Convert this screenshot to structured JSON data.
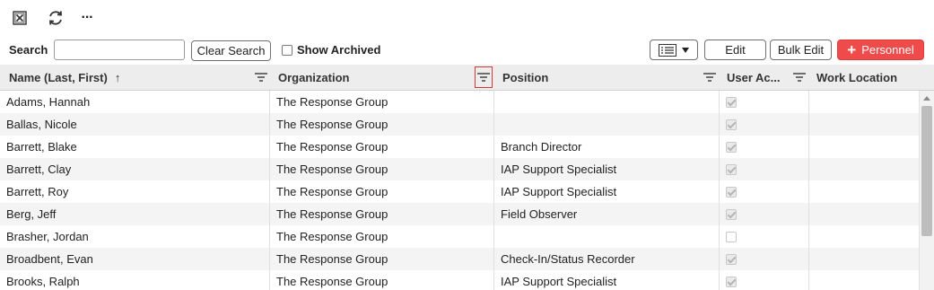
{
  "toolbar": {
    "search_label": "Search",
    "search_value": "",
    "clear_search_label": "Clear Search",
    "show_archived_label": "Show Archived",
    "edit_label": "Edit",
    "bulk_edit_label": "Bulk Edit",
    "personnel_label": "Personnel",
    "personnel_plus": "+"
  },
  "topbar": {
    "more_label": "···",
    "icons": [
      "excel-export-icon",
      "refresh-icon",
      "more-icon"
    ]
  },
  "columns": {
    "name": "Name (Last, First)",
    "sort_arrow": "↑",
    "organization": "Organization",
    "position": "Position",
    "user_account": "User Ac...",
    "work_location": "Work Location"
  },
  "rows": [
    {
      "name": "Adams, Hannah",
      "organization": "The Response Group",
      "position": "",
      "user": true
    },
    {
      "name": "Ballas, Nicole",
      "organization": "The Response Group",
      "position": "",
      "user": true
    },
    {
      "name": "Barrett, Blake",
      "organization": "The Response Group",
      "position": "Branch Director",
      "user": true
    },
    {
      "name": "Barrett, Clay",
      "organization": "The Response Group",
      "position": "IAP Support Specialist",
      "user": true
    },
    {
      "name": "Barrett, Roy",
      "organization": "The Response Group",
      "position": "IAP Support Specialist",
      "user": true
    },
    {
      "name": "Berg, Jeff",
      "organization": "The Response Group",
      "position": "Field Observer",
      "user": true
    },
    {
      "name": "Brasher, Jordan",
      "organization": "The Response Group",
      "position": "",
      "user": false
    },
    {
      "name": "Broadbent, Evan",
      "organization": "The Response Group",
      "position": "Check-In/Status Recorder",
      "user": true
    },
    {
      "name": "Brooks, Ralph",
      "organization": "The Response Group",
      "position": "IAP Support Specialist",
      "user": true
    }
  ],
  "colors": {
    "accent": "#ef4b4b",
    "header_bg": "#ededed",
    "row_alt": "#f4f4f4",
    "active_filter_border": "#d23a3a"
  }
}
